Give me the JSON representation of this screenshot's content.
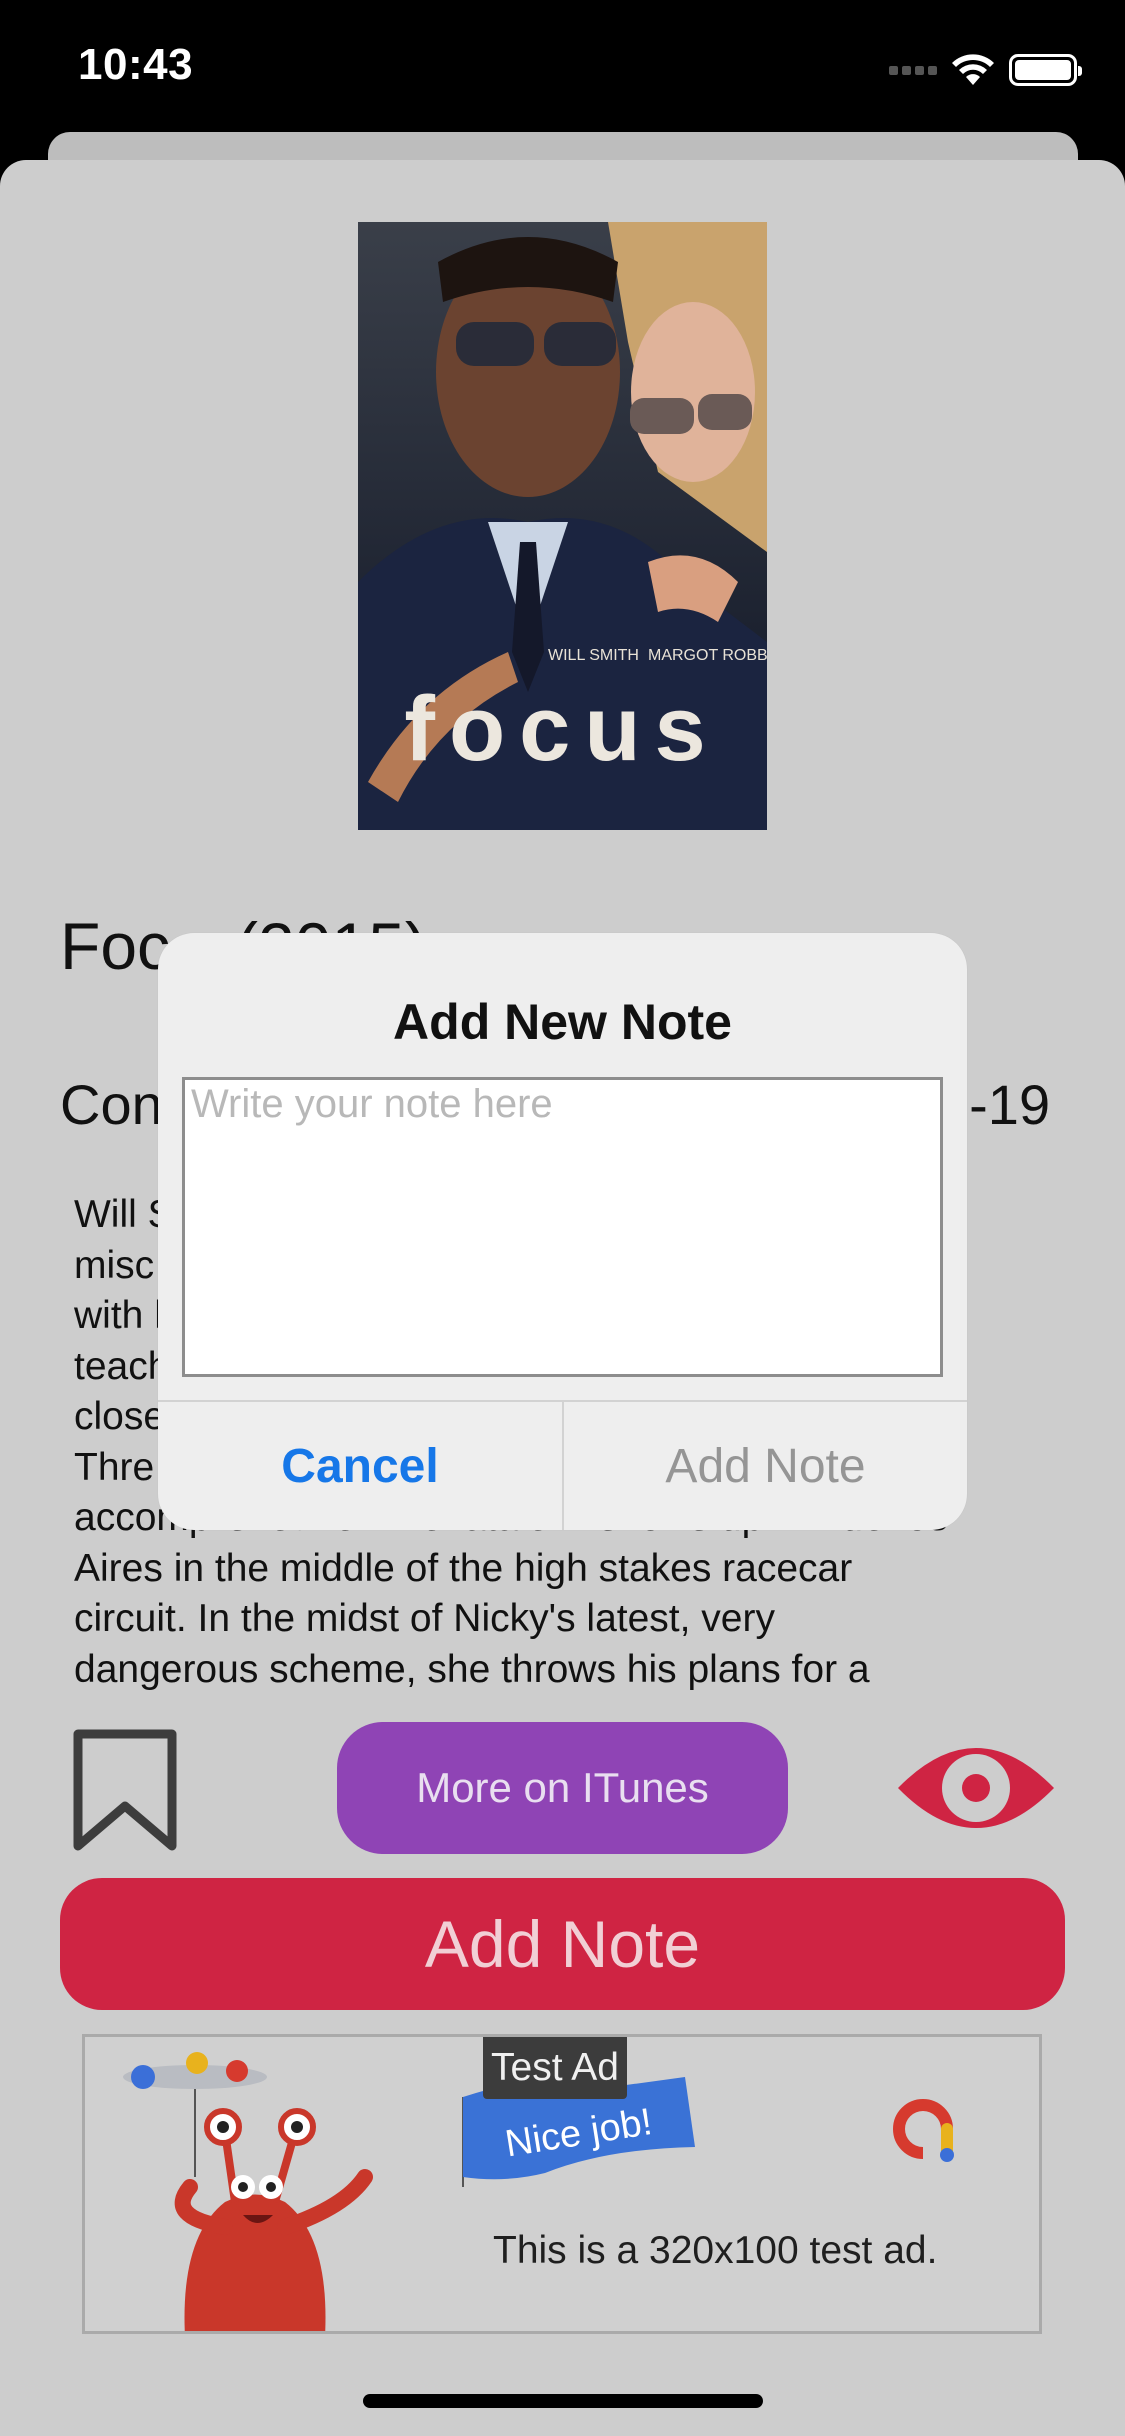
{
  "status_bar": {
    "time": "10:43"
  },
  "movie": {
    "title_visible": "Foc  (2015)",
    "info_left": "Con",
    "info_right": "3-19",
    "description_lines": [
      "Will S",
      "misc                                                    d",
      "with                                                     he's",
      "teach                                                   o",
      "close",
      "Thre",
      "accomplished femme fatale— shows up in Buenos",
      "Aires in the middle of the high stakes racecar",
      "circuit. In the midst of Nicky's latest, very",
      "dangerous scheme, she throws his plans for a"
    ],
    "poster_text": "focus",
    "poster_credit_left": "WILL SMITH",
    "poster_credit_right": "MARGOT ROBBIE"
  },
  "actions": {
    "itunes_label": "More on ITunes",
    "add_note_label": "Add Note"
  },
  "ad": {
    "label": "Test Ad",
    "flag_text": "Nice job!",
    "text": "This is a 320x100 test ad."
  },
  "dialog": {
    "title": "Add New Note",
    "placeholder": "Write your note here",
    "value": "",
    "cancel_label": "Cancel",
    "confirm_label": "Add Note"
  },
  "colors": {
    "itunes": "#8f44b5",
    "add_note": "#cf2443",
    "eye": "#cf2443",
    "cancel": "#1677e8",
    "sheet_bg": "#cdcdcd"
  },
  "icons": {
    "bookmark": "bookmark-icon",
    "eye": "eye-icon",
    "wifi": "wifi-icon",
    "battery": "battery-icon",
    "signal": "cellular-signal-icon"
  }
}
